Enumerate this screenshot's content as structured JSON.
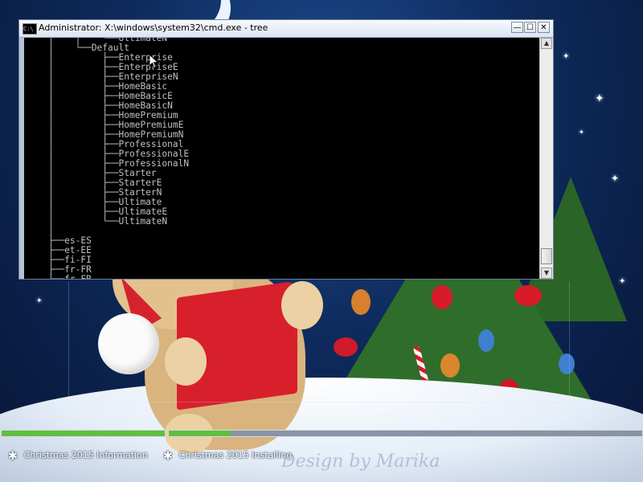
{
  "window": {
    "title": "Administrator: X:\\windows\\system32\\cmd.exe - tree",
    "icon": "C:\\",
    "buttons": {
      "minimize": "—",
      "maximize": "☐",
      "close": "✕"
    }
  },
  "console": {
    "lines": [
      "    │    │    └──UltimateN",
      "    │    └──Default",
      "    │         ├──Enterprise",
      "    │         ├──EnterpriseE",
      "    │         ├──EnterpriseN",
      "    │         ├──HomeBasic",
      "    │         ├──HomeBasicE",
      "    │         ├──HomeBasicN",
      "    │         ├──HomePremium",
      "    │         ├──HomePremiumE",
      "    │         ├──HomePremiumN",
      "    │         ├──Professional",
      "    │         ├──ProfessionalE",
      "    │         ├──ProfessionalN",
      "    │         ├──Starter",
      "    │         ├──StarterE",
      "    │         ├──StarterN",
      "    │         ├──Ultimate",
      "    │         ├──UltimateE",
      "    │         └──UltimateN",
      "    │",
      "    ├──es-ES",
      "    ├──et-EE",
      "    ├──fi-FI",
      "    ├──fr-FR",
      "    ├──fr-FR"
    ]
  },
  "scrollbar": {
    "up": "▲",
    "down": "▼"
  },
  "status": {
    "left_label": "Christmas 2015 Information",
    "right_label": "Christmas 2015 Installing",
    "icon": "✱",
    "progress_left": 1.0,
    "progress_right": 0.13
  },
  "watermark": "Design by Marika",
  "colors": {
    "progress_fill": "#5fbf3f",
    "console_bg": "#000000",
    "console_text": "#c0c0c0"
  }
}
